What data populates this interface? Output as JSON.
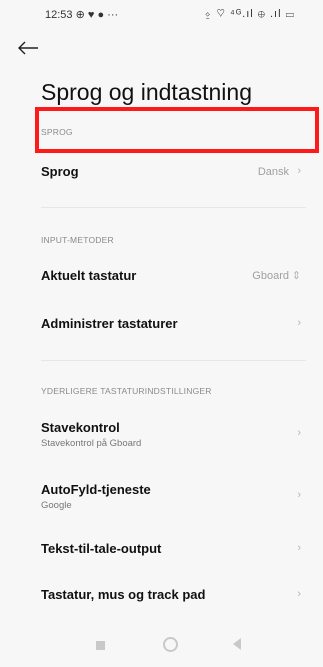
{
  "status_bar": {
    "time": "12:53",
    "left_icons": "⊕ ♥ ● ···",
    "right_icons": "⍚ ♡ ⁴ᴳ.ıl ⊕ .ıl ▭"
  },
  "header": {
    "title": "Sprog og indtastning"
  },
  "sections": {
    "sprog": {
      "header": "SPROG",
      "items": [
        {
          "label": "Sprog",
          "value": "Dansk"
        }
      ]
    },
    "input": {
      "header": "INPUT-METODER",
      "items": [
        {
          "label": "Aktuelt tastatur",
          "value": "Gboard"
        },
        {
          "label": "Administrer tastaturer"
        }
      ]
    },
    "more": {
      "header": "YDERLIGERE TASTATURINDSTILLINGER",
      "items": [
        {
          "label": "Stavekontrol",
          "sublabel": "Stavekontrol på Gboard"
        },
        {
          "label": "AutoFyld-tjeneste",
          "sublabel": "Google"
        },
        {
          "label": "Tekst-til-tale-output"
        },
        {
          "label": "Tastatur, mus og track pad"
        }
      ]
    }
  },
  "icons": {
    "back": "arrow-left-icon",
    "chevron": "chevron-right-icon",
    "updown": "chevron-updown-icon"
  },
  "colors": {
    "highlight": "#ff1a1a",
    "background": "#f7f7f7"
  }
}
